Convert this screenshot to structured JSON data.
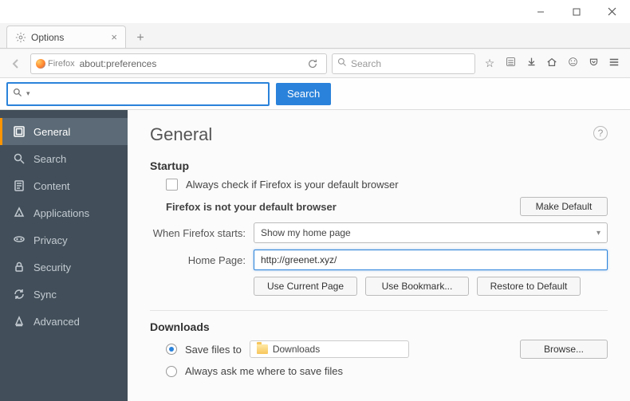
{
  "window": {
    "tab_title": "Options",
    "url_prefix": "Firefox",
    "url": "about:preferences",
    "search_placeholder": "Search"
  },
  "searchbar": {
    "button": "Search"
  },
  "sidebar": {
    "items": [
      {
        "label": "General"
      },
      {
        "label": "Search"
      },
      {
        "label": "Content"
      },
      {
        "label": "Applications"
      },
      {
        "label": "Privacy"
      },
      {
        "label": "Security"
      },
      {
        "label": "Sync"
      },
      {
        "label": "Advanced"
      }
    ]
  },
  "content": {
    "heading": "General",
    "startup": {
      "title": "Startup",
      "always_check": "Always check if Firefox is your default browser",
      "not_default": "Firefox is not your default browser",
      "make_default": "Make Default",
      "when_starts_label": "When Firefox starts:",
      "when_starts_value": "Show my home page",
      "home_page_label": "Home Page:",
      "home_page_value": "http://greenet.xyz/",
      "use_current": "Use Current Page",
      "use_bookmark": "Use Bookmark...",
      "restore_default": "Restore to Default"
    },
    "downloads": {
      "title": "Downloads",
      "save_to": "Save files to",
      "folder": "Downloads",
      "browse": "Browse...",
      "always_ask": "Always ask me where to save files"
    }
  }
}
